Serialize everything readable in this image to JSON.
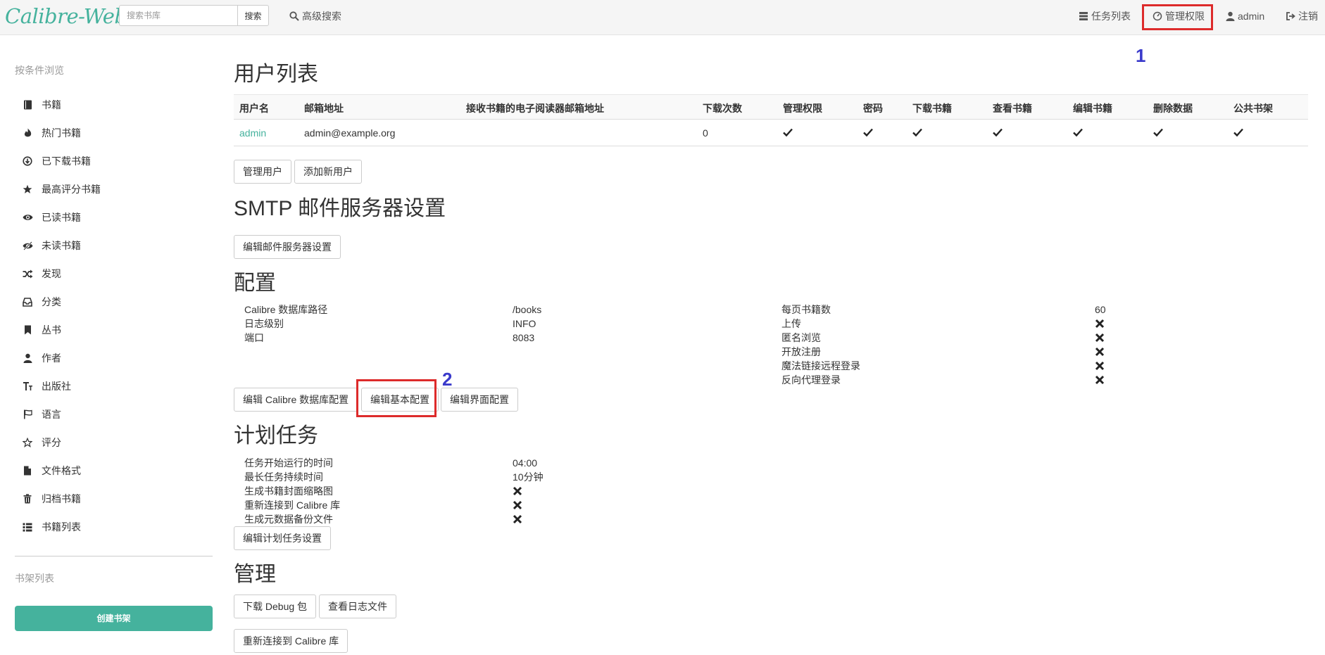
{
  "brand": {
    "logo_text": "Calibre-Web"
  },
  "search": {
    "placeholder": "搜索书库",
    "button": "搜索"
  },
  "topnav": {
    "advanced_search": "高级搜索",
    "tasks": "任务列表",
    "admin": "管理权限",
    "user": "admin",
    "logout": "注销"
  },
  "markers": {
    "one": "1",
    "two": "2"
  },
  "sidebar": {
    "heading": "按条件浏览",
    "items": [
      {
        "label": "书籍",
        "icon": "book-icon"
      },
      {
        "label": "热门书籍",
        "icon": "fire-icon"
      },
      {
        "label": "已下载书籍",
        "icon": "download-circle-icon"
      },
      {
        "label": "最高评分书籍",
        "icon": "star-icon"
      },
      {
        "label": "已读书籍",
        "icon": "eye-icon"
      },
      {
        "label": "未读书籍",
        "icon": "eye-slash-icon"
      },
      {
        "label": "发现",
        "icon": "random-icon"
      },
      {
        "label": "分类",
        "icon": "inbox-icon"
      },
      {
        "label": "丛书",
        "icon": "bookmark-icon"
      },
      {
        "label": "作者",
        "icon": "user-icon"
      },
      {
        "label": "出版社",
        "icon": "text-size-icon"
      },
      {
        "label": "语言",
        "icon": "flag-icon"
      },
      {
        "label": "评分",
        "icon": "star-empty-icon"
      },
      {
        "label": "文件格式",
        "icon": "file-icon"
      },
      {
        "label": "归档书籍",
        "icon": "trash-icon"
      },
      {
        "label": "书籍列表",
        "icon": "th-list-icon"
      }
    ],
    "shelves_heading": "书架列表",
    "create_shelf": "创建书架"
  },
  "users": {
    "title": "用户列表",
    "columns": [
      "用户名",
      "邮箱地址",
      "接收书籍的电子阅读器邮箱地址",
      "下载次数",
      "管理权限",
      "密码",
      "下载书籍",
      "查看书籍",
      "编辑书籍",
      "删除数据",
      "公共书架"
    ],
    "rows": [
      {
        "username": "admin",
        "email": "admin@example.org",
        "kindle": "",
        "downloads": "0",
        "admin": true,
        "password": true,
        "download": true,
        "view": true,
        "edit": true,
        "delete": true,
        "public_shelf": true
      }
    ],
    "manage_button": "管理用户",
    "add_button": "添加新用户"
  },
  "smtp": {
    "title": "SMTP 邮件服务器设置",
    "edit_button": "编辑邮件服务器设置"
  },
  "config": {
    "title": "配置",
    "left": [
      {
        "label": "Calibre 数据库路径",
        "value": "/books"
      },
      {
        "label": "日志级别",
        "value": "INFO"
      },
      {
        "label": "端口",
        "value": "8083"
      }
    ],
    "right": [
      {
        "label": "每页书籍数",
        "value": "60"
      },
      {
        "label": "上传",
        "value": false
      },
      {
        "label": "匿名浏览",
        "value": false
      },
      {
        "label": "开放注册",
        "value": false
      },
      {
        "label": "魔法链接远程登录",
        "value": false
      },
      {
        "label": "反向代理登录",
        "value": false
      }
    ],
    "edit_db_button": "编辑 Calibre 数据库配置",
    "edit_basic_button": "编辑基本配置",
    "edit_ui_button": "编辑界面配置"
  },
  "schedule": {
    "title": "计划任务",
    "rows": [
      {
        "label": "任务开始运行的时间",
        "value": "04:00"
      },
      {
        "label": "最长任务持续时间",
        "value": "10分钟"
      },
      {
        "label": "生成书籍封面缩略图",
        "value": false
      },
      {
        "label": "重新连接到 Calibre 库",
        "value": false
      },
      {
        "label": "生成元数据备份文件",
        "value": false
      }
    ],
    "edit_button": "编辑计划任务设置"
  },
  "admin": {
    "title": "管理",
    "debug_button": "下载 Debug 包",
    "logs_button": "查看日志文件",
    "reconnect_button": "重新连接到 Calibre 库"
  },
  "colors": {
    "accent": "#45b29d",
    "highlight": "#dd2b2b",
    "marker": "#3a3acb"
  }
}
